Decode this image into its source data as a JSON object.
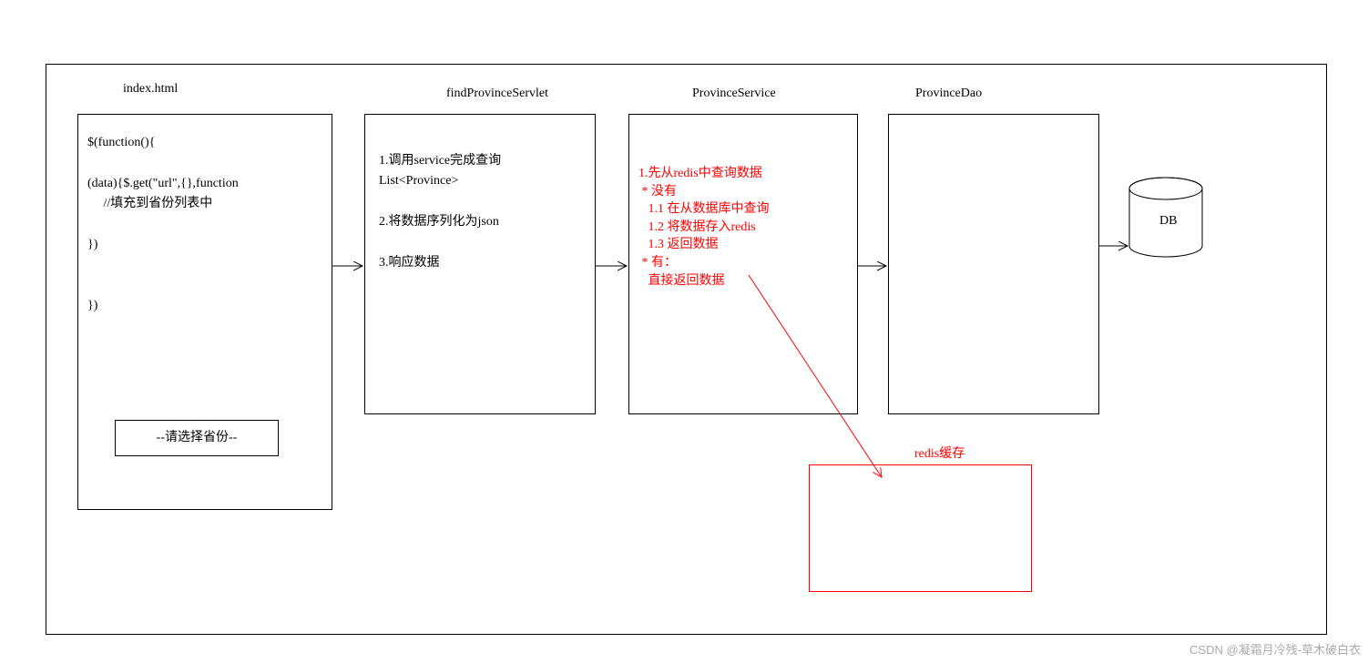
{
  "titles": {
    "index": "index.html",
    "servlet": "findProvinceServlet",
    "service": "ProvinceService",
    "dao": "ProvinceDao"
  },
  "box1": {
    "code": "$(function(){\n\n(data){$.get(\"url\",{},function\n     //填充到省份列表中\n\n})\n\n\n})",
    "dropdown": "--请选择省份--"
  },
  "box2": {
    "content": "1.调用service完成查询\nList<Province>\n\n2.将数据序列化为json\n\n3.响应数据"
  },
  "box3": {
    "content": "1.先从redis中查询数据\n * 没有\n   1.1 在从数据库中查询\n   1.2 将数据存入redis\n   1.3 返回数据\n * 有：\n   直接返回数据"
  },
  "redis_label": "redis缓存",
  "db_label": "DB",
  "watermark": "CSDN @凝霜月冷残-草木破白衣"
}
